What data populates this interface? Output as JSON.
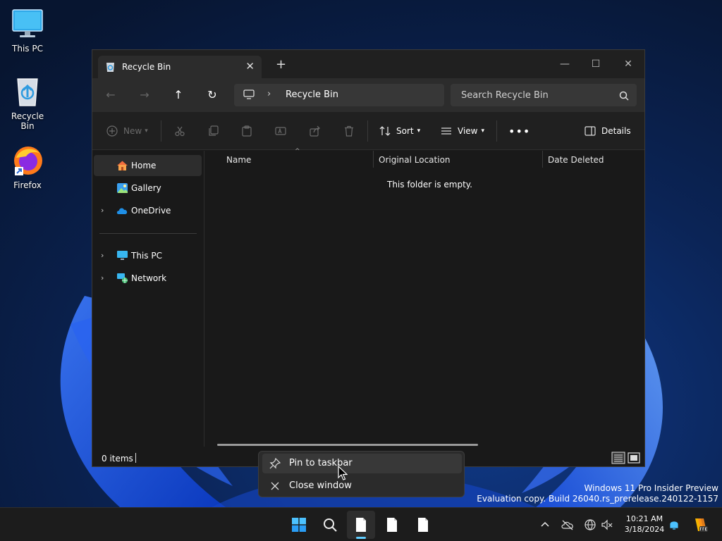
{
  "desktop": {
    "icons": [
      {
        "label": "This PC"
      },
      {
        "label": "Recycle Bin"
      },
      {
        "label": "Firefox"
      }
    ],
    "watermark": {
      "line1": "Windows 11 Pro Insider Preview",
      "line2": "Evaluation copy. Build 26040.rs_prerelease.240122-1157"
    }
  },
  "window": {
    "tab_title": "Recycle Bin",
    "address": {
      "crumb": "Recycle Bin"
    },
    "search_placeholder": "Search Recycle Bin",
    "toolbar": {
      "new_label": "New",
      "sort_label": "Sort",
      "view_label": "View",
      "details_label": "Details"
    },
    "sidebar": {
      "items": [
        {
          "label": "Home",
          "icon": "home-icon",
          "selected": true
        },
        {
          "label": "Gallery",
          "icon": "gallery-icon"
        },
        {
          "label": "OneDrive",
          "icon": "onedrive-icon",
          "expandable": true
        },
        {
          "label": "This PC",
          "icon": "this-pc-icon",
          "expandable": true
        },
        {
          "label": "Network",
          "icon": "network-icon",
          "expandable": true
        }
      ]
    },
    "columns": [
      "Name",
      "Original Location",
      "Date Deleted"
    ],
    "empty_message": "This folder is empty.",
    "status": {
      "item_count": "0 items"
    }
  },
  "context_menu": {
    "items": [
      {
        "label": "Pin to taskbar",
        "icon": "pin-icon"
      },
      {
        "label": "Close window",
        "icon": "close-icon"
      }
    ]
  },
  "taskbar": {
    "clock": {
      "time": "10:21 AM",
      "date": "3/18/2024"
    }
  },
  "colors": {
    "accent": "#60cdff",
    "window_bg": "#191919",
    "folder_yellow": "#f2b035"
  }
}
